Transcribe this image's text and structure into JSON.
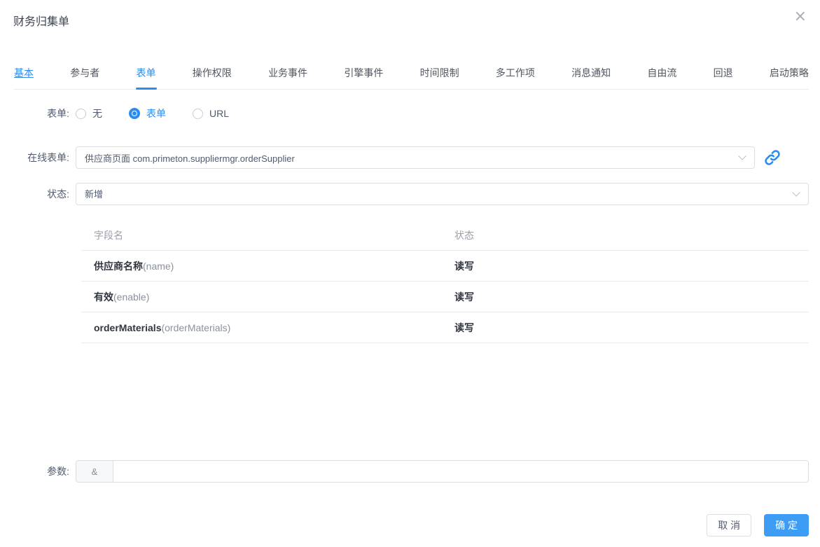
{
  "dialog": {
    "title": "财务归集单",
    "close_icon": "×"
  },
  "tabs": [
    {
      "label": "基本",
      "state": "link"
    },
    {
      "label": "参与者",
      "state": "normal"
    },
    {
      "label": "表单",
      "state": "active"
    },
    {
      "label": "操作权限",
      "state": "normal"
    },
    {
      "label": "业务事件",
      "state": "normal"
    },
    {
      "label": "引擎事件",
      "state": "normal"
    },
    {
      "label": "时间限制",
      "state": "normal"
    },
    {
      "label": "多工作项",
      "state": "normal"
    },
    {
      "label": "消息通知",
      "state": "normal"
    },
    {
      "label": "自由流",
      "state": "normal"
    },
    {
      "label": "回退",
      "state": "normal"
    },
    {
      "label": "启动策略",
      "state": "normal"
    }
  ],
  "form": {
    "form_type": {
      "label": "表单:",
      "options": [
        {
          "label": "无",
          "selected": false
        },
        {
          "label": "表单",
          "selected": true
        },
        {
          "label": "URL",
          "selected": false
        }
      ]
    },
    "online_form": {
      "label": "在线表单:",
      "value": "供应商页面 com.primeton.suppliermgr.orderSupplier"
    },
    "status": {
      "label": "状态:",
      "value": "新增"
    },
    "fields_table": {
      "columns": [
        "字段名",
        "状态"
      ],
      "rows": [
        {
          "name": "供应商名称",
          "code": "(name)",
          "status": "读写"
        },
        {
          "name": "有效",
          "code": "(enable)",
          "status": "读写"
        },
        {
          "name": "orderMaterials",
          "code": "(orderMaterials)",
          "status": "读写"
        }
      ]
    },
    "params": {
      "label": "参数:",
      "addon": "&",
      "value": "",
      "placeholder": ""
    }
  },
  "footer": {
    "cancel_label": "取 消",
    "ok_label": "确 定"
  },
  "icons": {
    "close": "x-close",
    "select_arrow": "chevron-down",
    "online_form_link": "chain-link"
  },
  "colors": {
    "primary": "#2d8cf0",
    "primary_button": "#3d9cf4",
    "border": "#dcdee2",
    "divider": "#e8eaec",
    "label_text": "#515a6e",
    "table_header_text": "#9aa0ab",
    "table_text": "#30353f",
    "addon_bg": "#f7f8fa"
  }
}
